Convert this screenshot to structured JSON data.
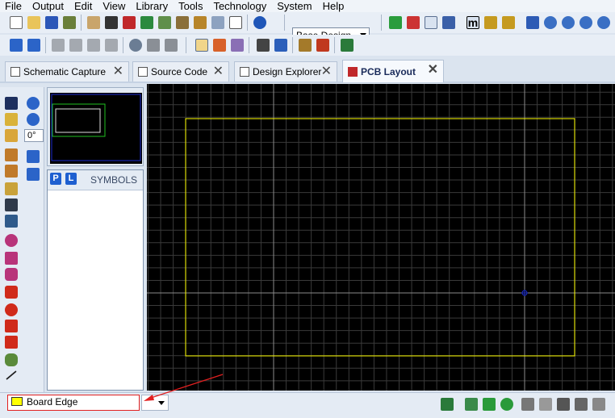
{
  "menu": [
    "File",
    "Output",
    "Edit",
    "View",
    "Library",
    "Tools",
    "Technology",
    "System",
    "Help"
  ],
  "toolbar": {
    "design_variant": "Base Design"
  },
  "tabs": [
    {
      "label": "Schematic Capture",
      "active": false
    },
    {
      "label": "Source Code",
      "active": false
    },
    {
      "label": "Design Explorer",
      "active": false
    },
    {
      "label": "PCB Layout",
      "active": true
    }
  ],
  "rotation": {
    "angle": "0°"
  },
  "selector": {
    "p_label": "P",
    "l_label": "L",
    "title": "SYMBOLS"
  },
  "layer": {
    "name": "Board Edge",
    "color": "#ffff00"
  },
  "colors": {
    "board_edge": "#ffff00",
    "grid": "#3a3a3a",
    "axis": "#8a8a8a",
    "origin_marker": "#2030c8",
    "annotation_arrow": "#e12020"
  }
}
